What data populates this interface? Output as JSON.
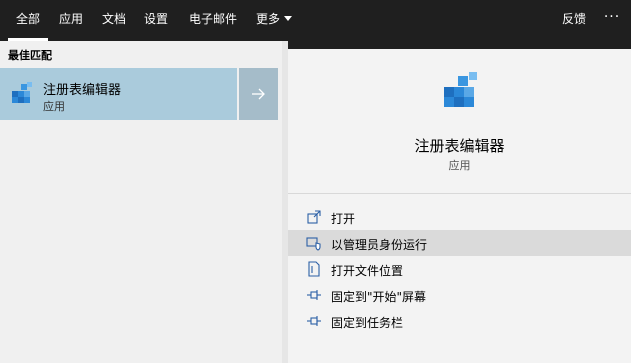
{
  "nav": {
    "tabs": [
      {
        "label": "全部"
      },
      {
        "label": "应用"
      },
      {
        "label": "文档"
      },
      {
        "label": "设置"
      },
      {
        "label": "电子邮件"
      },
      {
        "label": "更多"
      }
    ],
    "feedback": "反馈",
    "more_options": "···"
  },
  "left": {
    "section_label": "最佳匹配",
    "result": {
      "title": "注册表编辑器",
      "subtitle": "应用"
    }
  },
  "right": {
    "app_name": "注册表编辑器",
    "app_type": "应用",
    "actions": [
      {
        "label": "打开",
        "icon": "open-icon"
      },
      {
        "label": "以管理员身份运行",
        "icon": "run-as-admin-icon"
      },
      {
        "label": "打开文件位置",
        "icon": "file-location-icon"
      },
      {
        "label": "固定到\"开始\"屏幕",
        "icon": "pin-icon"
      },
      {
        "label": "固定到任务栏",
        "icon": "pin-icon"
      }
    ]
  },
  "colors": {
    "topbar": "#1f1f1f",
    "selected_row": "#aacbdc",
    "accent_blue": "#2b88d8"
  }
}
